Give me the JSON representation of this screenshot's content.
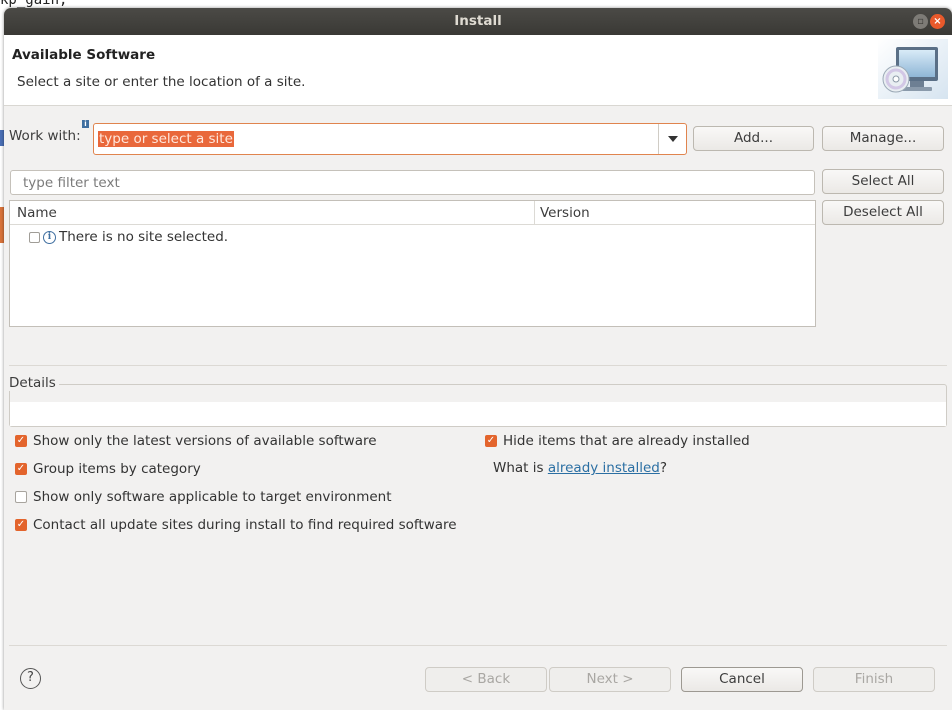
{
  "background": {
    "code_text": "kp_gain;"
  },
  "window": {
    "title": "Install",
    "close_glyph": "×"
  },
  "header": {
    "title": "Available Software",
    "description": "Select a site or enter the location of a site.",
    "icon": "computer-cd-icon"
  },
  "work_with": {
    "label": "Work with:",
    "info_glyph": "i",
    "placeholder": "type or select a site",
    "add_label": "Add...",
    "manage_label": "Manage..."
  },
  "filter": {
    "placeholder": "type filter text"
  },
  "selection": {
    "select_all_label": "Select All",
    "deselect_all_label": "Deselect All"
  },
  "table": {
    "columns": [
      "Name",
      "Version"
    ],
    "rows": [
      {
        "name": "There is no site selected.",
        "version": "",
        "checked": false
      }
    ],
    "info_glyph": "i"
  },
  "details": {
    "label": "Details",
    "text": ""
  },
  "options": {
    "latest_versions": {
      "label": "Show only the latest versions of available software",
      "checked": true
    },
    "group_by_category": {
      "label": "Group items by category",
      "checked": true
    },
    "target_env": {
      "label": "Show only software applicable to target environment",
      "checked": false
    },
    "contact_sites": {
      "label": "Contact all update sites during install to find required software",
      "checked": true
    },
    "hide_installed": {
      "label": "Hide items that are already installed",
      "checked": true
    },
    "what_is_prefix": "What is ",
    "what_is_link": "already installed",
    "what_is_suffix": "?",
    "check_glyph": "✓"
  },
  "footer": {
    "help_glyph": "?",
    "back_label": "< Back",
    "next_label": "Next >",
    "cancel_label": "Cancel",
    "finish_label": "Finish"
  },
  "colors": {
    "accent": "#e9683b",
    "checkbox_on": "#e3642c",
    "link": "#2b6fa3",
    "titlebar": "#3c3b37"
  }
}
